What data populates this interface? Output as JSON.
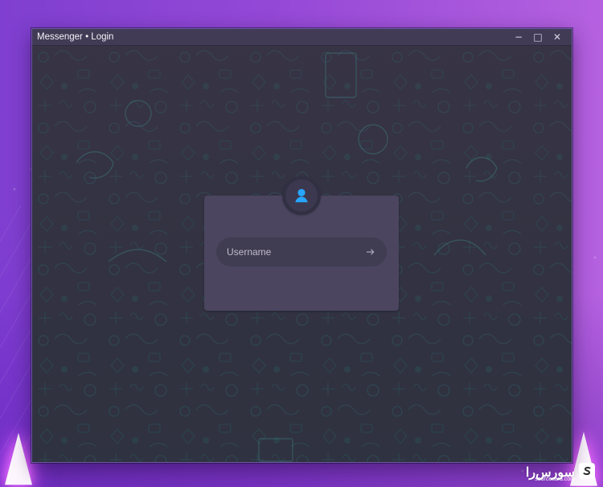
{
  "window": {
    "title": "Messenger • Login"
  },
  "controls": {
    "minimize": "−",
    "maximize": "□",
    "close": "✕"
  },
  "login": {
    "username_placeholder": "Username",
    "username_value": ""
  },
  "watermark": {
    "text": "سورس‌را",
    "domain": "sourcesara.com"
  },
  "icons": {
    "user": "user-icon",
    "submit": "arrow-right-icon",
    "logo": "sourcesara-logo-icon"
  },
  "colors": {
    "accent": "#27a6ff",
    "card": "#4b4560",
    "window": "#343041"
  }
}
